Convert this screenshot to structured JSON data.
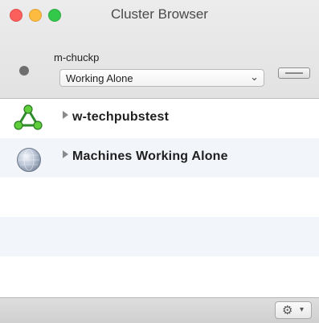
{
  "window": {
    "title": "Cluster Browser"
  },
  "colors": {
    "traffic_close": "#fc605c",
    "traffic_minimize": "#fdbc40",
    "traffic_zoom": "#34c84a"
  },
  "header": {
    "user_name": "m-chuckp",
    "mode_select": {
      "value": "Working Alone"
    },
    "status_indicator": "gray-dot"
  },
  "list": {
    "items": [
      {
        "label": "w-techpubstest",
        "icon": "cluster-network-icon"
      },
      {
        "label": "Machines Working Alone",
        "icon": "globe-icon"
      }
    ]
  },
  "footer": {
    "action_menu_icon": "gear-icon"
  }
}
